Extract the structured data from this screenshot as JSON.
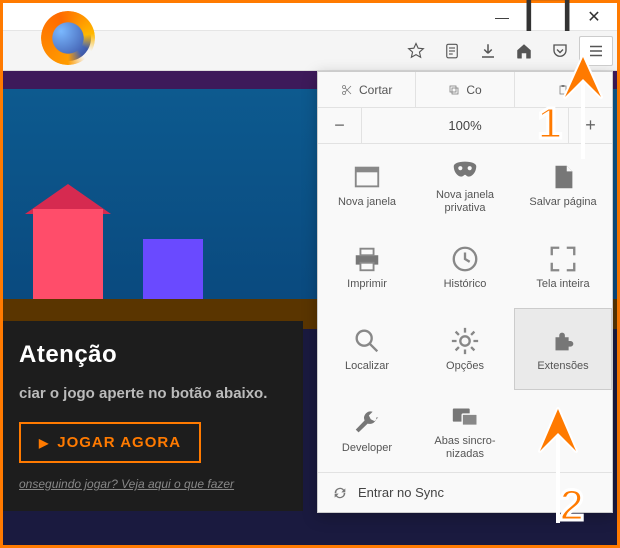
{
  "colors": {
    "accent": "#ff7a00"
  },
  "window": {
    "minimize": "—",
    "maximize": "▢",
    "close": "✕"
  },
  "toolbar": {
    "star": "☆",
    "reader": "▦",
    "download": "⬇",
    "home": "⌂",
    "pocket": "⌄",
    "menu": "≡"
  },
  "menu": {
    "clip": {
      "cut": "Cortar",
      "copy": "Co",
      "paste": ""
    },
    "zoom": {
      "value": "100%"
    },
    "items": [
      {
        "label": "Nova janela"
      },
      {
        "label": "Nova janela privativa"
      },
      {
        "label": "Salvar página"
      },
      {
        "label": "Imprimir"
      },
      {
        "label": "Histórico"
      },
      {
        "label": "Tela inteira"
      },
      {
        "label": "Localizar"
      },
      {
        "label": "Opções"
      },
      {
        "label": "Extensões"
      },
      {
        "label": "Developer"
      },
      {
        "label": "Abas sincro-nizadas"
      }
    ],
    "sync": "Entrar no Sync"
  },
  "page": {
    "attention": "Atenção",
    "subtitle": "ciar o jogo aperte no botão abaixo.",
    "play": "JOGAR AGORA",
    "help": "onseguindo jogar? Veja aqui o que fazer"
  },
  "annotations": {
    "one": "1",
    "two": "2"
  }
}
